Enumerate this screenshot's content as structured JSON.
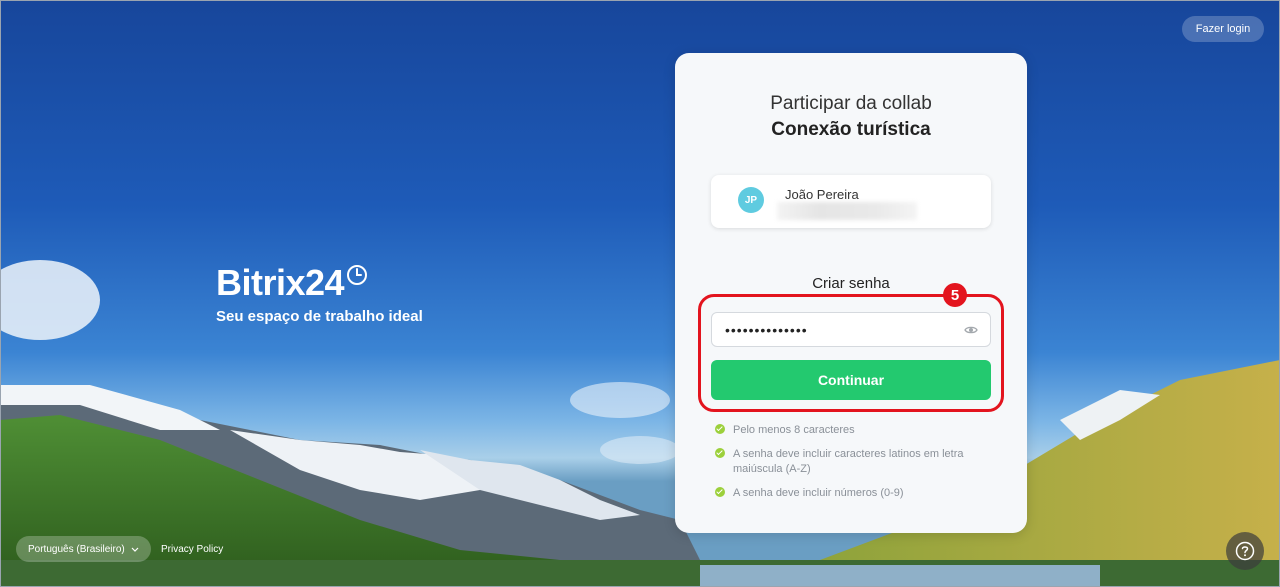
{
  "header": {
    "login_label": "Fazer login"
  },
  "brand": {
    "name": "Bitrix24",
    "tagline": "Seu espaço de trabalho ideal"
  },
  "card": {
    "title": "Participar da collab",
    "subtitle": "Conexão turística",
    "user": {
      "initials": "JP",
      "name": "João Pereira"
    },
    "password": {
      "label": "Criar senha",
      "value": "••••••••••••••",
      "visibility_icon": "eye-icon"
    },
    "submit_label": "Continuar",
    "requirements": [
      "Pelo menos 8 caracteres",
      "A senha deve incluir caracteres latinos em letra maiúscula (A-Z)",
      "A senha deve incluir números (0-9)"
    ]
  },
  "annotation": {
    "step": "5",
    "color": "#e3141e"
  },
  "footer": {
    "language": "Português (Brasileiro)",
    "privacy_label": "Privacy Policy",
    "help_icon": "question-icon"
  },
  "colors": {
    "accent": "#23c96f",
    "check": "#9cd03b",
    "avatar": "#5fcbe0"
  }
}
